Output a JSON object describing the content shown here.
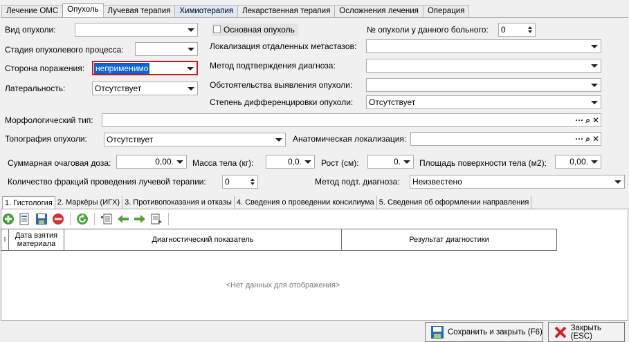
{
  "tabs": [
    "Лечение ОМС",
    "Опухоль",
    "Лучевая терапия",
    "Химиотерапия",
    "Лекарственная терапия",
    "Осложнения лечения",
    "Операция"
  ],
  "form": {
    "tumor_type_label": "Вид опухоли:",
    "tumor_type_value": "",
    "main_tumor_label": "Основная опухоль",
    "tumor_number_label": "№ опухоли у данного больного:",
    "tumor_number_value": "0",
    "stage_label": "Стадия опухолевого процесса:",
    "stage_value": "",
    "metastasis_label": "Локализация отдаленных метастазов:",
    "metastasis_value": "",
    "side_label": "Сторона поражения:",
    "side_value": "неприменимо",
    "confirm_method_label": "Метод подтверждения диагноза:",
    "confirm_method_value": "",
    "laterality_label": "Латеральность:",
    "laterality_value": "Отсутствует",
    "circumstances_label": "Обстоятельства выявления опухоли:",
    "circumstances_value": "",
    "differentiation_label": "Степень дифференцировки опухоли:",
    "differentiation_value": "Отсутствует",
    "morph_label": "Морфологический тип:",
    "morph_value": "",
    "topography_label": "Топография опухоли:",
    "topography_value": "Отсутствует",
    "anat_label": "Анатомическая локализация:",
    "anat_value": "",
    "dose_label": "Суммарная очаговая доза:",
    "dose_value": "0,00.",
    "mass_label": "Масса тела (кг):",
    "mass_value": "0,0.",
    "height_label": "Рост (см):",
    "height_value": "0.",
    "area_label": "Площадь поверхности тела (м2):",
    "area_value": "0,00.",
    "fractions_label": "Количество фракций проведения лучевой терапии:",
    "fractions_value": "0",
    "diag_method_label": "Метод подт. диагноза:",
    "diag_method_value": "Неизвестено",
    "lookup_buttons": [
      "···",
      "⌕",
      "✕"
    ]
  },
  "lower_tabs": [
    "1. Гистология",
    "2. Маркёры (ИГХ)",
    "3. Противопоказания и отказы",
    "4. Сведения о проведении консилиума",
    "5. Сведения об оформлении направления"
  ],
  "grid": {
    "headers": [
      "Дата взятия материала",
      "Диагностический показатель",
      "Результат диагностики"
    ],
    "empty_text": "<Нет данных для отображения>",
    "row_selector_icon": "⁝"
  },
  "buttons": {
    "save_close": "Сохранить и закрыть (F6)",
    "close": "Закрыть (ESC)"
  },
  "colors": {
    "accent_red": "#d0141c",
    "selection_blue": "#0a64d6"
  }
}
